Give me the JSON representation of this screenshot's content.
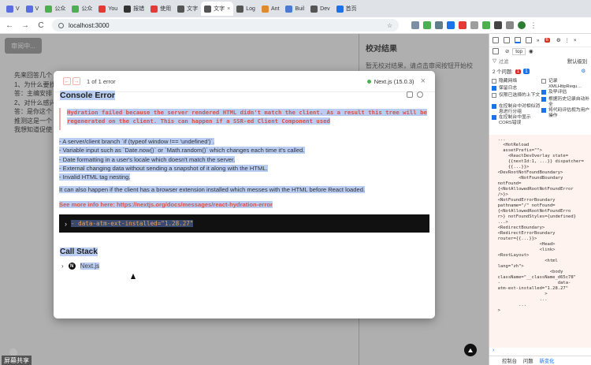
{
  "tabs": [
    {
      "label": "V",
      "color": "#5b6ee1"
    },
    {
      "label": "V",
      "color": "#5b6ee1"
    },
    {
      "label": "公众",
      "color": "#4caf50"
    },
    {
      "label": "公众",
      "color": "#4caf50"
    },
    {
      "label": "You",
      "color": "#e53935"
    },
    {
      "label": "报错",
      "color": "#333333"
    },
    {
      "label": "使用",
      "color": "#e53935"
    },
    {
      "label": "文字",
      "color": "#555555"
    },
    {
      "label": "文字",
      "color": "#555555",
      "active": true
    },
    {
      "label": "Log",
      "color": "#555555"
    },
    {
      "label": "Ant",
      "color": "#e08a2e"
    },
    {
      "label": "Buil",
      "color": "#4a7bd0"
    },
    {
      "label": "Dev",
      "color": "#555555"
    },
    {
      "label": "首页",
      "color": "#1a73e8"
    }
  ],
  "toolbar": {
    "back": "←",
    "forward": "→",
    "reload": "C",
    "url": "localhost:3000",
    "star": "☆"
  },
  "page": {
    "review_button": "审阅中...",
    "lines": [
      "先来回答几个",
      "1、为什么要找",
      "答：主编安排",
      "2、对什么感兴",
      "答：是你这个",
      "推测这是一个",
      "我想知道促使"
    ],
    "side_title": "校对结果",
    "side_hint": "暂无校对结果，请点击审阅按钮开始校"
  },
  "dialog": {
    "prev": "←",
    "next": "→",
    "error_count": "1 of 1 error",
    "next_version": "Next.js (15.0.3)",
    "close": "×",
    "title": "Console Error",
    "hydration_1": "Hydration failed because the server rendered HTML didn't match the client. As a result this tree will be",
    "hydration_2": "regenerated on the client. This can happen if a SSR-ed Client Component used",
    "bullets": [
      "- A server/client branch `if (typeof window !== 'undefined')`.",
      "- Variable input such as `Date.now()` or `Math.random()` which changes each time it's called.",
      "- Date formatting in a user's locale which doesn't match the server.",
      "- External changing data without sending a snapshot of it along with the HTML.",
      "- Invalid HTML tag nesting."
    ],
    "also": "It can also happen if the client has a browser extension installed which messes with the HTML before React loaded.",
    "more_info": "See more info here: https://nextjs.org/docs/messages/react-hydration-error",
    "code_chevron": "›",
    "code_attr": "- data-atm-ext-installed=\"1.28.27\"",
    "callstack_title": "Call Stack",
    "frame_chevron": "›",
    "frame_logo": "N",
    "frame_label": "Next.js"
  },
  "overlay_misc": {
    "screenshare": "屏幕共享"
  },
  "devtools": {
    "top_tabs": [
      "»"
    ],
    "error_badge": "6",
    "filter_top": "top",
    "filter_label": "过滤",
    "level_label": "默认级别",
    "issues_label": "2 个问题:",
    "issues_red": "1",
    "issues_blue": "1",
    "checkboxes_left": [
      {
        "label": "隐藏网络",
        "on": false
      },
      {
        "label": "保留日志",
        "on": true
      },
      {
        "label": "仅限已选择的上下文",
        "on": false
      },
      {
        "label": "在控制台中对相似消息进行分组",
        "on": true
      },
      {
        "label": "在控制台中显示 CORS错误",
        "on": true
      }
    ],
    "checkboxes_right": [
      {
        "label": "记录 XMLHttpRequ…",
        "on": false
      },
      {
        "label": "及早评估",
        "on": true
      },
      {
        "label": "根据历史记录自动补全",
        "on": true
      },
      {
        "label": "将代码评估视为用户操作",
        "on": true
      }
    ],
    "dom_lines": [
      "  ...",
      "    <HotReload",
      "    assetPrefix=\"\">",
      "      <ReactDevOverlay state=",
      "      {{nextId:1, ...}} dispatcher=",
      "      {{...}}>",
      "",
      "  <DevRootNotFoundBoundary>",
      "          <NotFoundBoundary",
      "  notFound=",
      "  {<NotAllowedRootNotFoundError",
      "  />}>",
      "",
      "  <NotFoundErrorBoundary",
      "  pathname=\"/\" notFound=",
      "  {<NotAllowedRootNotFoundErro",
      "  r>} notFoundStyles={undefined}",
      "  ...>",
      "",
      "  <RedirectBoundary>",
      "",
      "  <RedirectErrorBoundary",
      "  router={{...}}>",
      "                  <Head>",
      "                  <link>",
      "",
      "  <RootLayout>",
      "                    <html",
      "  lang=\"zh\">",
      "                      <body",
      "",
      "  className=\"__className_d65c78\"",
      "  -                      data-",
      "  atm-ext-installed=\"1.28.27\"",
      "                    >",
      "                  ...",
      "          ...",
      "",
      "  >"
    ],
    "bottom_tabs": [
      "控制台",
      "问题",
      "新变化"
    ],
    "bottom_selected": "新变化"
  }
}
